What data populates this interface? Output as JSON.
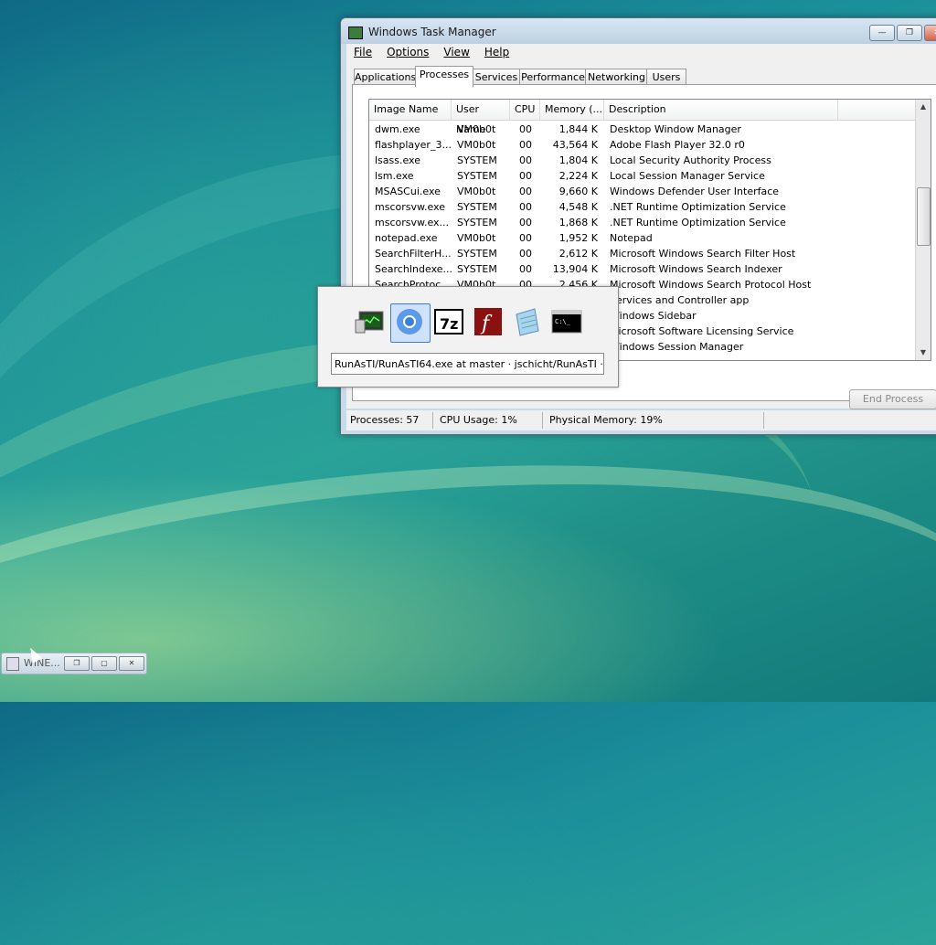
{
  "window": {
    "title": "Windows Task Manager",
    "buttons": {
      "minimize": "—",
      "maximize": "❐",
      "close": "✕"
    }
  },
  "menu": [
    "File",
    "Options",
    "View",
    "Help"
  ],
  "tabs": [
    {
      "label": "Applications",
      "active": false
    },
    {
      "label": "Processes",
      "active": true
    },
    {
      "label": "Services",
      "active": false
    },
    {
      "label": "Performance",
      "active": false
    },
    {
      "label": "Networking",
      "active": false
    },
    {
      "label": "Users",
      "active": false
    }
  ],
  "columns": [
    "Image Name",
    "User Name",
    "CPU",
    "Memory (...",
    "Description"
  ],
  "rows": [
    [
      "dwm.exe",
      "VM0b0t",
      "00",
      "1,844 K",
      "Desktop Window Manager"
    ],
    [
      "flashplayer_3...",
      "VM0b0t",
      "00",
      "43,564 K",
      "Adobe Flash Player 32.0 r0"
    ],
    [
      "lsass.exe",
      "SYSTEM",
      "00",
      "1,804 K",
      "Local Security Authority Process"
    ],
    [
      "lsm.exe",
      "SYSTEM",
      "00",
      "2,224 K",
      "Local Session Manager Service"
    ],
    [
      "MSASCui.exe",
      "VM0b0t",
      "00",
      "9,660 K",
      "Windows Defender User Interface"
    ],
    [
      "mscorsvw.exe",
      "SYSTEM",
      "00",
      "4,548 K",
      ".NET Runtime Optimization Service"
    ],
    [
      "mscorsvw.ex...",
      "SYSTEM",
      "00",
      "1,868 K",
      ".NET Runtime Optimization Service"
    ],
    [
      "notepad.exe",
      "VM0b0t",
      "00",
      "1,952 K",
      "Notepad"
    ],
    [
      "SearchFilterH...",
      "SYSTEM",
      "00",
      "2,612 K",
      "Microsoft Windows Search Filter Host"
    ],
    [
      "SearchIndexe...",
      "SYSTEM",
      "00",
      "13,904 K",
      "Microsoft Windows Search Indexer"
    ],
    [
      "SearchProtoc...",
      "VM0b0t",
      "00",
      "2,456 K",
      "Microsoft Windows Search Protocol Host"
    ],
    [
      "",
      "",
      "",
      "",
      "Services and Controller app"
    ],
    [
      "",
      "",
      "",
      "",
      "Windows Sidebar"
    ],
    [
      "",
      "",
      "",
      "",
      "Microsoft Software Licensing Service"
    ],
    [
      "",
      "",
      "",
      "",
      "Windows Session Manager"
    ]
  ],
  "end_process_label": "End Process",
  "status": {
    "processes": "Processes: 57",
    "cpu": "CPU Usage: 1%",
    "memory": "Physical Memory: 19%"
  },
  "switcher": {
    "icons": [
      "task-manager-icon",
      "chromium-icon",
      "7zip-icon",
      "flash-player-icon",
      "notepad-icon",
      "command-prompt-icon"
    ],
    "selected_text": "RunAsTI/RunAsTI64.exe at master · jschicht/RunAsTI · ..."
  },
  "minimized": {
    "label": "WINE..."
  }
}
